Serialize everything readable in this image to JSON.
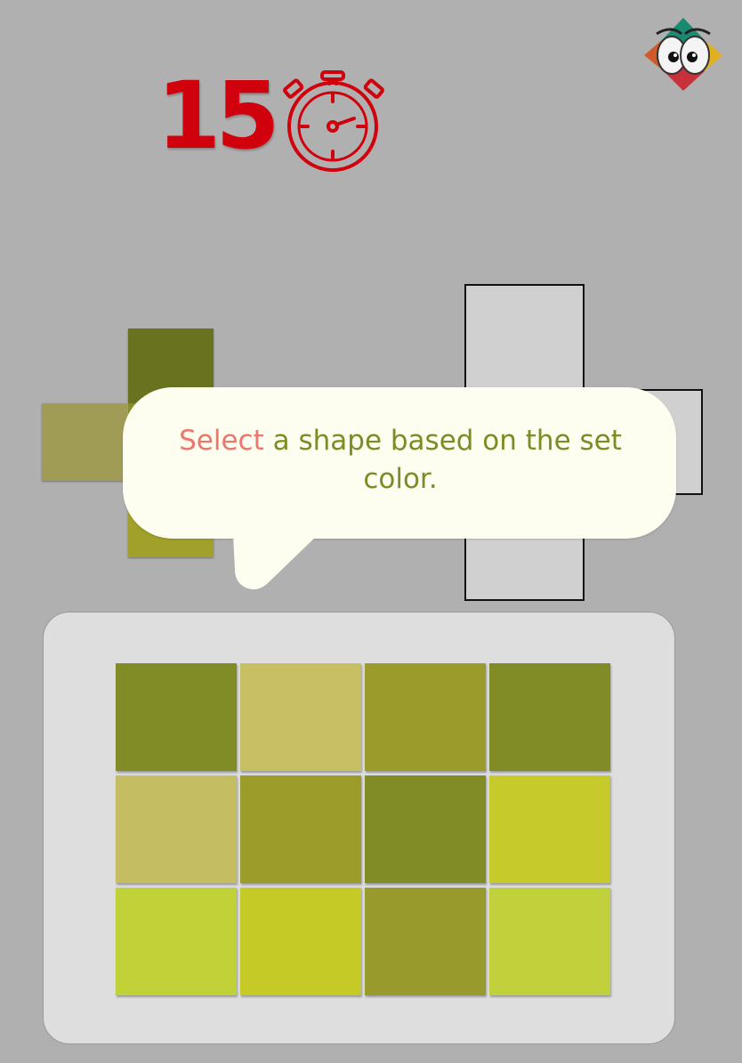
{
  "timer": {
    "count": "15",
    "icon": "stopwatch-icon",
    "color": "#d0000d"
  },
  "logo": {
    "icon": "cartoon-eyes-logo"
  },
  "target": {
    "colors": {
      "top": "#68721f",
      "left": "#a09c55",
      "middle": "#8a8b2a",
      "bottom": "#a0a02a"
    }
  },
  "slots": {
    "fill": "#d0d0d0",
    "border": "#111111",
    "count": 4
  },
  "hint": {
    "accent_word": "Select",
    "rest_text": " a shape based on the set color.",
    "accent_color": "#f0756a",
    "text_color": "#7f8b25"
  },
  "palette": {
    "swatches": [
      {
        "name": "swatch-1",
        "color": "#828c27"
      },
      {
        "name": "swatch-2",
        "color": "#c8bf64"
      },
      {
        "name": "swatch-3",
        "color": "#9a9b2a"
      },
      {
        "name": "swatch-4",
        "color": "#828c27"
      },
      {
        "name": "swatch-5",
        "color": "#c4bd62"
      },
      {
        "name": "swatch-6",
        "color": "#9c9c2b"
      },
      {
        "name": "swatch-7",
        "color": "#828c27"
      },
      {
        "name": "swatch-8",
        "color": "#c6ca2b"
      },
      {
        "name": "swatch-9",
        "color": "#c1d138"
      },
      {
        "name": "swatch-10",
        "color": "#c6ca27"
      },
      {
        "name": "swatch-11",
        "color": "#989a2c"
      },
      {
        "name": "swatch-12",
        "color": "#c1d13b"
      }
    ]
  }
}
